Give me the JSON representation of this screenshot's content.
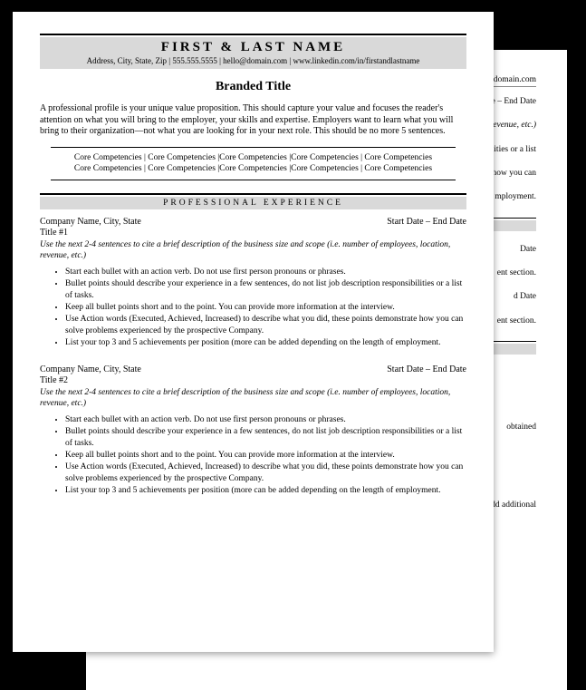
{
  "header": {
    "name": "FIRST & LAST NAME",
    "contact": "Address, City, State, Zip | 555.555.5555 | hello@domain.com | www.linkedin.com/in/firstandlastname"
  },
  "branded_title": "Branded Title",
  "profile": "A professional profile is your unique value proposition. This should capture your value and focuses the reader's attention on what you will bring to the employer, your skills and expertise. Employers want to learn what you will bring to their organization—not what you are looking for in your next role. This should be no more 5 sentences.",
  "competencies": {
    "line1": "Core Competencies | Core Competencies |Core Competencies |Core Competencies | Core Competencies",
    "line2": "Core Competencies | Core Competencies |Core Competencies |Core Competencies | Core Competencies"
  },
  "sections": {
    "experience_heading": "PROFESSIONAL EXPERIENCE"
  },
  "jobs": [
    {
      "company": "Company Name, City, State",
      "dates": "Start Date – End Date",
      "title": "Title #1",
      "scope": "Use the next 2-4 sentences to cite a brief description of the business size and scope (i.e. number of employees, location, revenue, etc.)",
      "bullets": [
        "Start each bullet with an action verb. Do not use first person pronouns or phrases.",
        "Bullet points should describe your experience in a few sentences, do not list job description responsibilities or a list of tasks.",
        "Keep all bullet points short and to the point. You can provide more information at the interview.",
        "Use Action words (Executed, Achieved, Increased) to describe what you did, these points demonstrate how you can solve problems experienced by the prospective Company.",
        "List your top 3 and 5 achievements per position (more can be added depending on the length of employment."
      ]
    },
    {
      "company": "Company Name, City, State",
      "dates": "Start Date – End Date",
      "title": "Title #2",
      "scope": "Use the next 2-4 sentences to cite a brief description of the business size and scope (i.e. number of employees, location, revenue, etc.)",
      "bullets": [
        "Start each bullet with an action verb. Do not use first person pronouns or phrases.",
        "Bullet points should describe your experience in a few sentences, do not list job description responsibilities or a list of tasks.",
        "Keep all bullet points short and to the point. You can provide more information at the interview.",
        "Use Action words (Executed, Achieved, Increased) to describe what you did, these points demonstrate how you can solve problems experienced by the prospective Company.",
        "List your top 3 and 5 achievements per position (more can be added depending on the length of employment."
      ]
    }
  ],
  "page2": {
    "contact_frag": "o@domain.com",
    "frags": [
      "rt Date – End Date",
      "ation, revenue, etc.)",
      "sibilities or a list",
      "trate how you can",
      "mployment.",
      "Date",
      "ent section.",
      "d Date",
      "ent section.",
      "obtained",
      "to add additional"
    ]
  }
}
